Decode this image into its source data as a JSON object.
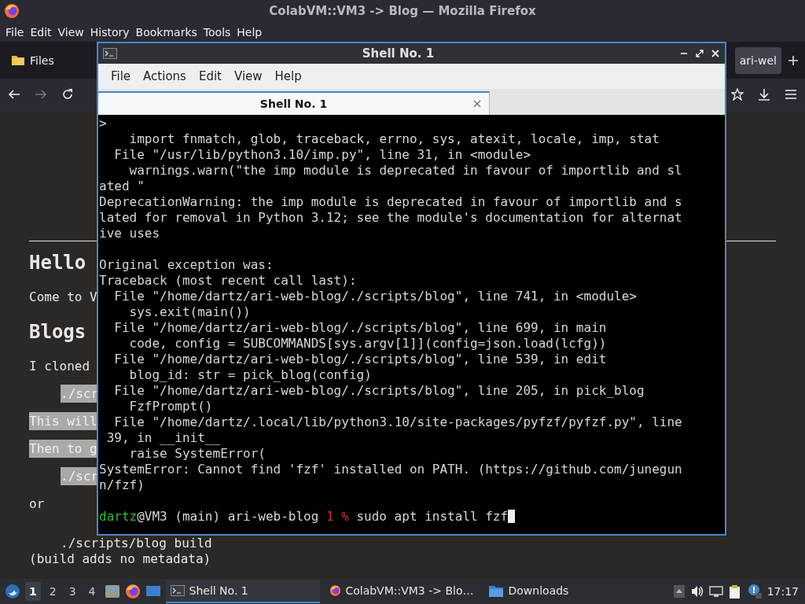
{
  "browser": {
    "title": "ColabVM::VM3 -> Blog — Mozilla Firefox",
    "menu": [
      "File",
      "Edit",
      "View",
      "History",
      "Bookmarks",
      "Tools",
      "Help"
    ],
    "tabs": [
      {
        "label": "Files",
        "kind": "folder",
        "selected": false
      },
      {
        "label": "ari-wel",
        "kind": "page",
        "selected": true
      }
    ],
    "forward_disabled": true,
    "page": [
      {
        "kind": "rule"
      },
      {
        "kind": "h1",
        "text": "Hello"
      },
      {
        "kind": "p",
        "text": "Come to V"
      },
      {
        "kind": "h1",
        "text": "Blogs"
      },
      {
        "kind": "p",
        "text": "I cloned"
      },
      {
        "kind": "code",
        "text": "./scr"
      },
      {
        "kind": "hl",
        "text": "This will"
      },
      {
        "kind": "hl",
        "text": "Then to g"
      },
      {
        "kind": "code",
        "text": "./scr"
      },
      {
        "kind": "p",
        "text": "or"
      },
      {
        "kind": "pre",
        "text": "./scripts/blog build"
      },
      {
        "kind": "p",
        "text": "(build adds no metadata)"
      }
    ]
  },
  "terminal": {
    "title": "Shell No. 1",
    "menu": [
      "File",
      "Actions",
      "Edit",
      "View",
      "Help"
    ],
    "tabs": [
      {
        "label": "Shell No. 1",
        "selected": true
      }
    ],
    "lines": [
      {
        "kind": "out",
        "text": ">"
      },
      {
        "kind": "out",
        "text": "    import fnmatch, glob, traceback, errno, sys, atexit, locale, imp, stat"
      },
      {
        "kind": "out",
        "text": "  File \"/usr/lib/python3.10/imp.py\", line 31, in <module>"
      },
      {
        "kind": "out",
        "text": "    warnings.warn(\"the imp module is deprecated in favour of importlib and sl"
      },
      {
        "kind": "out",
        "text": "ated \""
      },
      {
        "kind": "out",
        "text": "DeprecationWarning: the imp module is deprecated in favour of importlib and s"
      },
      {
        "kind": "out",
        "text": "lated for removal in Python 3.12; see the module's documentation for alternat"
      },
      {
        "kind": "out",
        "text": "ive uses"
      },
      {
        "kind": "blank"
      },
      {
        "kind": "out",
        "text": "Original exception was:"
      },
      {
        "kind": "out",
        "text": "Traceback (most recent call last):"
      },
      {
        "kind": "out",
        "text": "  File \"/home/dartz/ari-web-blog/./scripts/blog\", line 741, in <module>"
      },
      {
        "kind": "out",
        "text": "    sys.exit(main())"
      },
      {
        "kind": "out",
        "text": "  File \"/home/dartz/ari-web-blog/./scripts/blog\", line 699, in main"
      },
      {
        "kind": "out",
        "text": "    code, config = SUBCOMMANDS[sys.argv[1]](config=json.load(lcfg))"
      },
      {
        "kind": "out",
        "text": "  File \"/home/dartz/ari-web-blog/./scripts/blog\", line 539, in edit"
      },
      {
        "kind": "out",
        "text": "    blog_id: str = pick_blog(config)"
      },
      {
        "kind": "out",
        "text": "  File \"/home/dartz/ari-web-blog/./scripts/blog\", line 205, in pick_blog"
      },
      {
        "kind": "out",
        "text": "    FzfPrompt()"
      },
      {
        "kind": "out",
        "text": "  File \"/home/dartz/.local/lib/python3.10/site-packages/pyfzf/pyfzf.py\", line"
      },
      {
        "kind": "out",
        "text": " 39, in __init__"
      },
      {
        "kind": "out",
        "text": "    raise SystemError("
      },
      {
        "kind": "out",
        "text": "SystemError: Cannot find 'fzf' installed on PATH. (https://github.com/junegun"
      },
      {
        "kind": "out",
        "text": "n/fzf)"
      },
      {
        "kind": "blank"
      }
    ],
    "prompt": {
      "user": "dartz",
      "host": "@VM3 (main) ari-web-blog",
      "status": "1 %",
      "command": "sudo apt install fzf"
    }
  },
  "taskbar": {
    "workspaces": [
      {
        "label": "1",
        "selected": true
      },
      {
        "label": "2",
        "selected": false
      },
      {
        "label": "3",
        "selected": false
      },
      {
        "label": "4",
        "selected": false
      }
    ],
    "tasks": [
      {
        "label": "Shell No. 1",
        "kind": "terminal",
        "selected": true
      },
      {
        "label": "ColabVM::VM3 -> Blo…",
        "kind": "firefox",
        "selected": false
      },
      {
        "label": "Downloads",
        "kind": "folder",
        "selected": false
      }
    ],
    "clock": "17:17"
  }
}
